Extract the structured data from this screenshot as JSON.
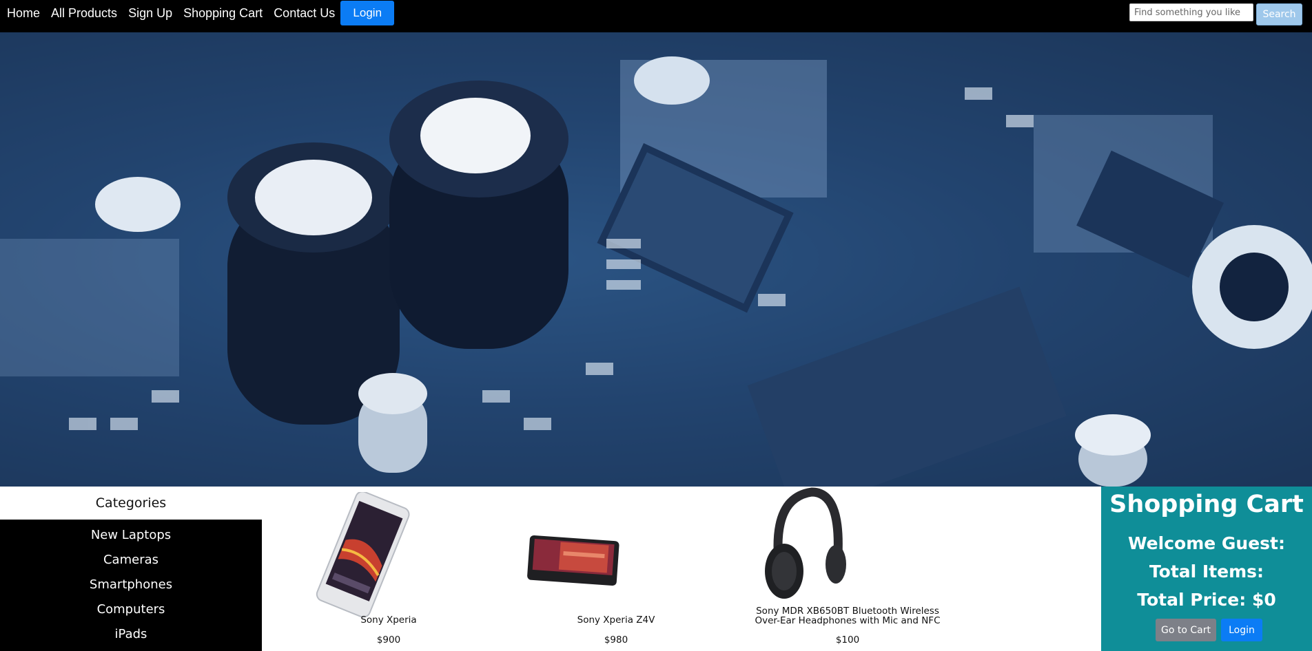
{
  "nav": {
    "links": [
      "Home",
      "All Products",
      "Sign Up",
      "Shopping Cart",
      "Contact Us"
    ],
    "login_label": "Login",
    "search_placeholder": "Find something you like",
    "search_label": "Search"
  },
  "categories": {
    "title": "Categories",
    "items": [
      "New Laptops",
      "Cameras",
      "Smartphones",
      "Computers",
      "iPads"
    ]
  },
  "products": [
    {
      "name": "Sony Xperia",
      "price": "$900"
    },
    {
      "name": "Sony Xperia Z4V",
      "price": "$980"
    },
    {
      "name": "Sony MDR XB650BT Bluetooth Wireless Over-Ear Headphones with Mic and NFC",
      "price": "$100"
    }
  ],
  "cart": {
    "title": "Shopping Cart",
    "welcome": "Welcome Guest:",
    "total_items": "Total Items:",
    "total_price": "Total Price: $0",
    "go_label": "Go to Cart",
    "login_label": "Login"
  }
}
